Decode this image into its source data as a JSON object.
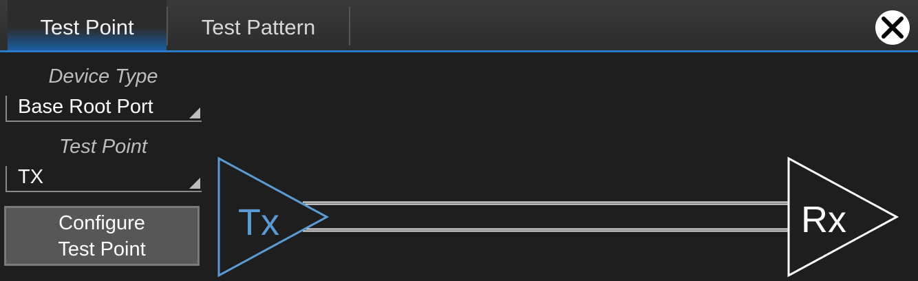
{
  "tabs": [
    {
      "label": "Test Point",
      "active": true
    },
    {
      "label": "Test Pattern",
      "active": false
    }
  ],
  "close": {
    "icon": "close-icon"
  },
  "device_type": {
    "label": "Device Type",
    "value": "Base Root Port"
  },
  "test_point": {
    "label": "Test Point",
    "value": "TX"
  },
  "configure_button": {
    "line1": "Configure",
    "line2": "Test Point"
  },
  "diagram": {
    "tx_label": "Tx",
    "rx_label": "Rx",
    "tx_color": "#5b9bd5",
    "rx_color": "#ffffff"
  },
  "colors": {
    "accent": "#2a7bc8",
    "background": "#1e1e1e"
  }
}
